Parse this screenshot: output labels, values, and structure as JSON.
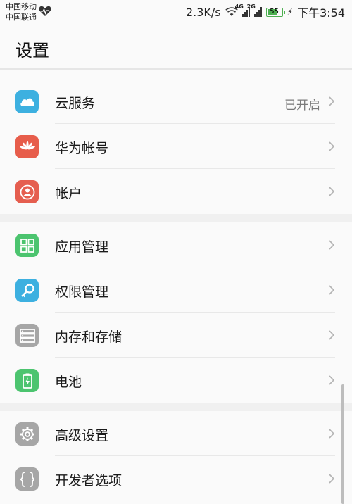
{
  "status_bar": {
    "carrier_1": "中国移动",
    "carrier_2": "中国联通",
    "net_speed": "2.3K/s",
    "sim1_network": "4G",
    "sim2_network": "2G",
    "battery_level": "55",
    "time": "下午3:54"
  },
  "header": {
    "title": "设置"
  },
  "sections": [
    {
      "items": [
        {
          "label": "云服务",
          "value": "已开启",
          "icon": "cloud-icon",
          "color": "#3db0e0"
        },
        {
          "label": "华为帐号",
          "icon": "huawei-logo-icon",
          "color": "#e75d4b"
        },
        {
          "label": "帐户",
          "icon": "account-icon",
          "color": "#e55e4f"
        }
      ]
    },
    {
      "items": [
        {
          "label": "应用管理",
          "icon": "apps-grid-icon",
          "color": "#4cc46f"
        },
        {
          "label": "权限管理",
          "icon": "key-icon",
          "color": "#3db0e0"
        },
        {
          "label": "内存和存储",
          "icon": "storage-icon",
          "color": "#a6a6a6"
        },
        {
          "label": "电池",
          "icon": "battery-icon",
          "color": "#4cc46f"
        }
      ]
    },
    {
      "items": [
        {
          "label": "高级设置",
          "icon": "gear-icon",
          "color": "#a6a6a6"
        },
        {
          "label": "开发者选项",
          "icon": "braces-icon",
          "color": "#a6a6a6"
        }
      ]
    }
  ]
}
